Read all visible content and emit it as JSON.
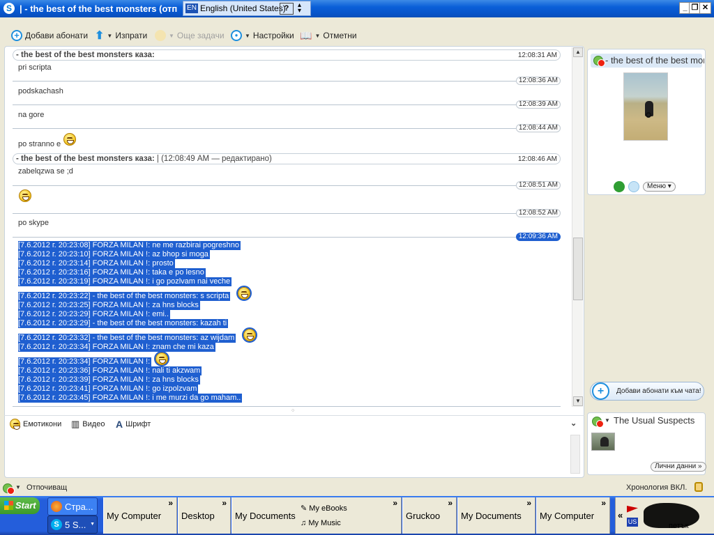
{
  "window": {
    "title": "| - the best of the best monsters (отп",
    "language": {
      "code": "EN",
      "name": "English (United States)",
      "help": "?"
    },
    "controls": {
      "minimize": "_",
      "restore": "❐",
      "close": "✕"
    }
  },
  "toolbar": {
    "add_contacts": "Добави абонати",
    "send": "Изпрати",
    "more_tasks": "Още задачи",
    "settings": "Настройки",
    "bookmarks": "Отметни"
  },
  "messages": [
    {
      "sender": "- the best of the best monsters каза:",
      "time": "12:08:31 AM",
      "text": "pri scripta"
    },
    {
      "time": "12:08:36 AM",
      "text": "podskachash"
    },
    {
      "time": "12:08:39 AM",
      "text": "na gore"
    },
    {
      "time": "12:08:44 AM",
      "text": "po stranno e",
      "smiley": true
    },
    {
      "sender": "- the best of the best monsters каза:",
      "edited": "| (12:08:49 AM — редактирано)",
      "time": "12:08:46 AM",
      "text": "zabelqzwa se ;d"
    },
    {
      "time": "12:08:51 AM",
      "text": "",
      "smiley": true
    },
    {
      "time": "12:08:52 AM",
      "text": "po skype"
    }
  ],
  "selected_time": "12:09:36 AM",
  "pasted_lines": [
    {
      "text": "[7.6.2012 г. 20:23:08] FORZA MILAN !: ne me razbirai pogreshno"
    },
    {
      "text": "[7.6.2012 г. 20:23:10] FORZA MILAN !: az bhop si moga"
    },
    {
      "text": "[7.6.2012 г. 20:23:14] FORZA MILAN !: prosto"
    },
    {
      "text": "[7.6.2012 г. 20:23:16] FORZA MILAN !: taka e po lesno"
    },
    {
      "text": "[7.6.2012 г. 20:23:19] FORZA MILAN !: i go pozlvam nai veche"
    },
    {
      "text": "[7.6.2012 г. 20:23:22] - the best of the best monsters: s scripta",
      "smiley": true
    },
    {
      "text": "[7.6.2012 г. 20:23:25] FORZA MILAN !: za hns blocks"
    },
    {
      "text": "[7.6.2012 г. 20:23:29] FORZA MILAN !: emi.."
    },
    {
      "text": "[7.6.2012 г. 20:23:29] - the best of the best monsters: kazah ti"
    },
    {
      "text": "[7.6.2012 г. 20:23:32] - the best of the best monsters: az wijdam",
      "smiley": true
    },
    {
      "text": "[7.6.2012 г. 20:23:34] FORZA MILAN !: znam che mi kaza"
    },
    {
      "text": "[7.6.2012 г. 20:23:34] FORZA MILAN !:",
      "smiley": true
    },
    {
      "text": "[7.6.2012 г. 20:23:36] FORZA MILAN !: nali ti akzwam"
    },
    {
      "text": "[7.6.2012 г. 20:23:39] FORZA MILAN !: za hns blocks"
    },
    {
      "text": "[7.6.2012 г. 20:23:41] FORZA MILAN !: go izpolzvam"
    },
    {
      "text": "[7.6.2012 г. 20:23:45] FORZA MILAN !: i me murzi da go maham.."
    }
  ],
  "compose": {
    "emoticons": "Емотикони",
    "video": "Видео",
    "font": "Шрифт"
  },
  "contact_panel": {
    "name": "- the best of the best monsters",
    "menu": "Меню",
    "add_to_chat": "Добави абонати към чата!"
  },
  "group_panel": {
    "name": "The Usual Suspects",
    "profile": "Лични данни »"
  },
  "status_bar": {
    "status": "Отпочиващ",
    "history": "Хронология ВКЛ."
  },
  "taskbar": {
    "start": "Start",
    "tasks": [
      "Стра...",
      "5 S..."
    ],
    "toolbars": [
      "My Computer",
      "Desktop",
      "My Documents",
      "Gruckoo",
      "My Documents",
      "My Computer"
    ],
    "sub_links": [
      "My eBooks",
      "My Music"
    ],
    "tray": {
      "lang": "US",
      "day": "петък"
    }
  },
  "colors": {
    "selection": "#1f5fd0",
    "titlebar": "#0a5fd8",
    "taskbar": "#245edb"
  }
}
